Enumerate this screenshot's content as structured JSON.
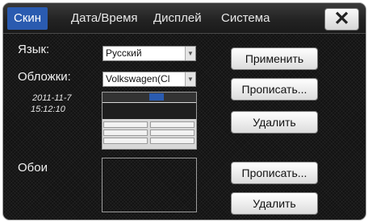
{
  "tabs": [
    {
      "label": "Скин",
      "active": true
    },
    {
      "label": "Дата/Время",
      "active": false
    },
    {
      "label": "Дисплей",
      "active": false
    },
    {
      "label": "Система",
      "active": false
    }
  ],
  "close_icon": "close-x-icon",
  "close_glyph": "✕",
  "language": {
    "label": "Язык:",
    "value": "Русский"
  },
  "skins": {
    "label": "Обложки:",
    "value": "Volkswagen(Cl"
  },
  "datetime": {
    "date": "2011-11-7",
    "time": "15:12:10"
  },
  "wallpaper": {
    "label": "Обои"
  },
  "buttons": {
    "apply": "Применить",
    "write_skin": "Прописать...",
    "delete_skin": "Удалить",
    "write_wallpaper": "Прописать...",
    "delete_wallpaper": "Удалить"
  },
  "colors": {
    "accent": "#2a5bb0",
    "background": "#121212"
  }
}
